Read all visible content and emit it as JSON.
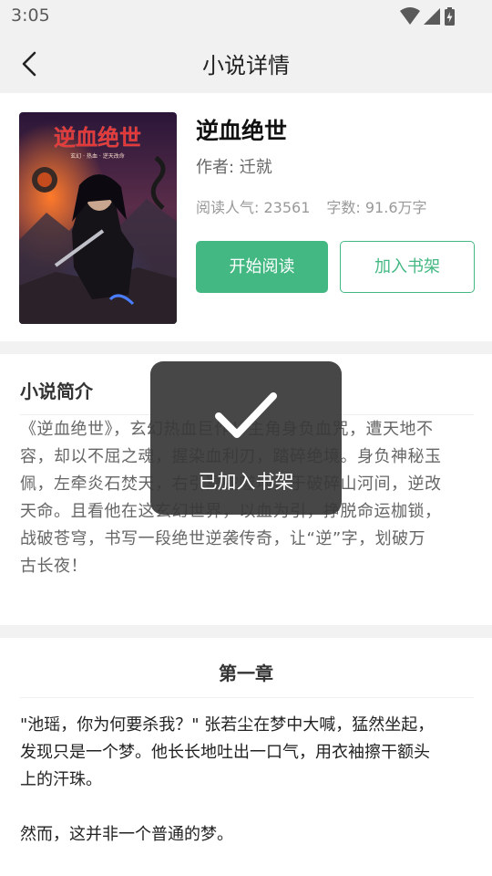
{
  "status_bar": {
    "time": "3:05"
  },
  "app_bar": {
    "title": "小说详情",
    "back_icon": "chevron-left-icon"
  },
  "book": {
    "title": "逆血绝世",
    "author": "作者: 迁就",
    "popularity": "阅读人气: 23561",
    "word_count": "字数: 91.6万字",
    "cover_title": "逆血绝世",
    "cover_subtitle": "玄幻 · 热血 · 逆天改命",
    "read_button": "开始阅读",
    "shelf_button": "加入书架",
    "accent_color": "#43b883"
  },
  "intro": {
    "heading": "小说简介",
    "lines": [
      "《逆血绝世》，玄幻热血巨作！主角身负血咒，遭天地不",
      "容，却以不屈之魂，握染血利刃，踏碎绝境。身负神秘玉",
      "佩，左牵炎石焚天，右引冥蛇噬地，于破碎山河间，逆改",
      "天命。且看他在这玄幻世界，以血为引，挣脱命运枷锁，",
      "战破苍穹，书写一段绝世逆袭传奇，让“逆”字，划破万",
      "古长夜！"
    ]
  },
  "chapter": {
    "heading": "第一章",
    "lines": [
      "\"池瑶，你为何要杀我？\" 张若尘在梦中大喊，猛然坐起，",
      "发现只是一个梦。他长长地吐出一口气，用衣袖擦干额头",
      "上的汗珠。",
      "",
      "然而，这并非一个普通的梦。"
    ]
  },
  "toast": {
    "text": "已加入书架",
    "icon": "checkmark-icon"
  }
}
